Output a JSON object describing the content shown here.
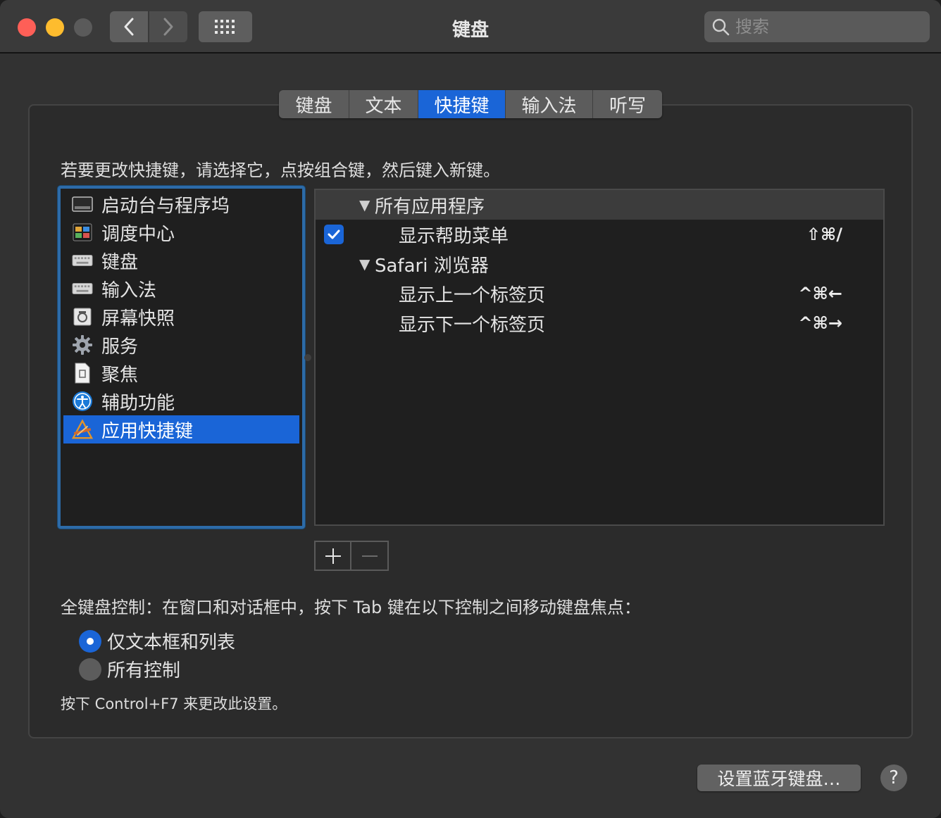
{
  "window": {
    "title": "键盘"
  },
  "search": {
    "placeholder": "搜索"
  },
  "tabs": [
    {
      "label": "键盘",
      "active": false
    },
    {
      "label": "文本",
      "active": false
    },
    {
      "label": "快捷键",
      "active": true
    },
    {
      "label": "输入法",
      "active": false
    },
    {
      "label": "听写",
      "active": false
    }
  ],
  "instruction": "若要更改快捷键，请选择它，点按组合键，然后键入新键。",
  "categories": [
    {
      "label": "启动台与程序坞",
      "icon": "launchpad-dock-icon"
    },
    {
      "label": "调度中心",
      "icon": "mission-control-icon"
    },
    {
      "label": "键盘",
      "icon": "keyboard-icon"
    },
    {
      "label": "输入法",
      "icon": "keyboard-icon"
    },
    {
      "label": "屏幕快照",
      "icon": "screenshot-icon"
    },
    {
      "label": "服务",
      "icon": "gear-icon"
    },
    {
      "label": "聚焦",
      "icon": "spotlight-icon"
    },
    {
      "label": "辅助功能",
      "icon": "accessibility-icon"
    },
    {
      "label": "应用快捷键",
      "icon": "app-shortcuts-icon",
      "selected": true
    }
  ],
  "shortcuts": {
    "group1": {
      "label": "所有应用程序"
    },
    "item1": {
      "label": "显示帮助菜单",
      "keys": "⇧⌘/",
      "checked": true
    },
    "group2": {
      "label": "Safari 浏览器"
    },
    "item2": {
      "label": "显示上一个标签页",
      "keys": "^⌘←"
    },
    "item3": {
      "label": "显示下一个标签页",
      "keys": "^⌘→"
    }
  },
  "full_keyboard": {
    "label": "全键盘控制：在窗口和对话框中，按下 Tab 键在以下控制之间移动键盘焦点：",
    "options": [
      {
        "label": "仅文本框和列表",
        "selected": true
      },
      {
        "label": "所有控制",
        "selected": false
      }
    ],
    "note": "按下 Control+F7 来更改此设置。"
  },
  "buttons": {
    "bluetooth": "设置蓝牙键盘…",
    "help": "?"
  },
  "colors": {
    "accent": "#1a65d7",
    "close": "#fe5f57",
    "minimize": "#febc2e"
  }
}
